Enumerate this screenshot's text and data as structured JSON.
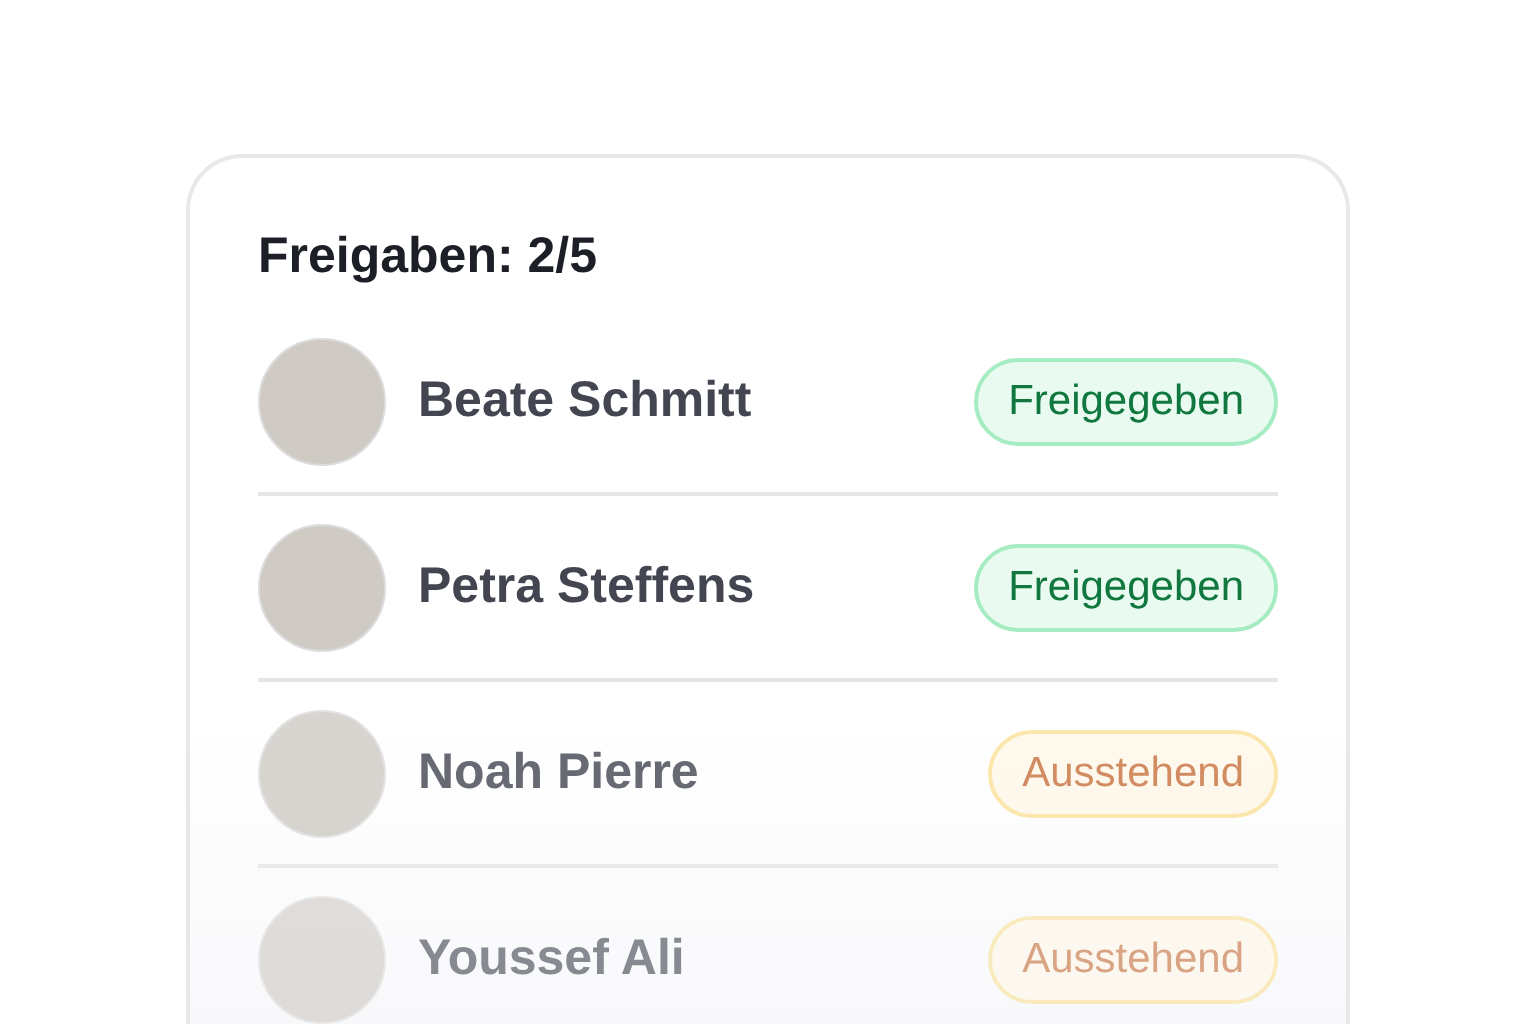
{
  "card": {
    "title": "Freigaben: 2/5"
  },
  "reviewers": [
    {
      "name": "Beate Schmitt",
      "status": {
        "kind": "approved",
        "label": "Freigegeben"
      }
    },
    {
      "name": "Petra Steffens",
      "status": {
        "kind": "approved",
        "label": "Freigegeben"
      }
    },
    {
      "name": "Noah Pierre",
      "status": {
        "kind": "pending",
        "label": "Ausstehend"
      }
    },
    {
      "name": "Youssef Ali",
      "status": {
        "kind": "pending",
        "label": "Ausstehend"
      }
    }
  ]
}
